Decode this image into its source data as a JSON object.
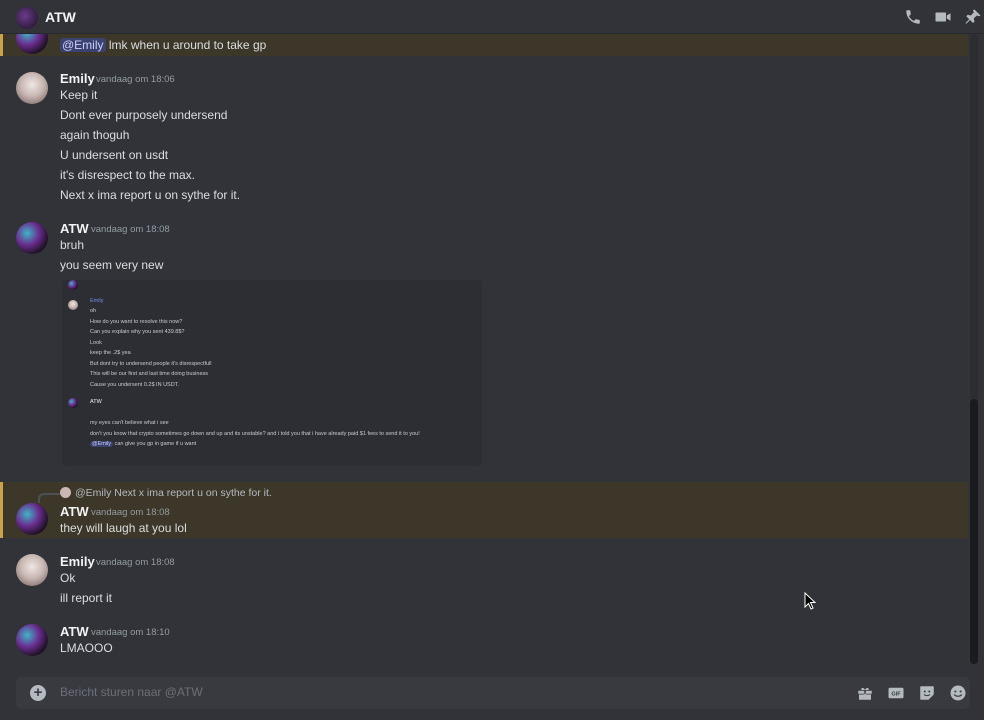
{
  "header": {
    "title": "ATW"
  },
  "messages": {
    "m0": {
      "mention": "@Emily",
      "text": "lmk when u around to take gp"
    },
    "m1": {
      "author": "Emily",
      "time": "vandaag om 18:06",
      "lines": [
        "Keep it",
        "Dont ever purposely undersend",
        "again thoguh",
        "U undersent on usdt",
        "it's disrespect to the max.",
        "Next x ima report u on sythe for it."
      ]
    },
    "m2": {
      "author": "ATW",
      "time": "vandaag om 18:08",
      "lines": [
        "bruh",
        "you seem very new"
      ]
    },
    "attachment": {
      "a_name": "Emily",
      "a_lines": [
        "oh",
        "How do you want to resolve this now?",
        "Can you explain why you sent 439.8$?",
        "Look",
        "keep the .2$ yea",
        "But dont try to undersend people it's disrespectfull",
        "This will be our first and last time doing business",
        "Cause you undersent 0.2$ IN USDT."
      ],
      "b_name": "ATW",
      "b_lines": [
        "my eyes can't believe what i see",
        "don't you know that crypto sometimes go down and up and its unstable? and i told you that i have already paid $1 fees to send it to you!",
        "can give you gp in game if u want"
      ],
      "b_mention": "@Emily"
    },
    "m3": {
      "reply_to": "@Emily",
      "reply_text": "Next x ima report u on sythe for it.",
      "author": "ATW",
      "time": "vandaag om 18:08",
      "lines": [
        "they will laugh at you lol"
      ]
    },
    "m4": {
      "author": "Emily",
      "time": "vandaag om 18:08",
      "lines": [
        "Ok",
        "ill report it"
      ]
    },
    "m5": {
      "author": "ATW",
      "time": "vandaag om 18:10",
      "lines": [
        "LMAOOO"
      ]
    }
  },
  "composer": {
    "placeholder": "Bericht sturen naar @ATW"
  },
  "icons": [
    "phone-icon",
    "video-icon",
    "pin-icon",
    "add-icon",
    "gift-icon",
    "gif-icon",
    "sticker-icon",
    "emoji-icon"
  ]
}
